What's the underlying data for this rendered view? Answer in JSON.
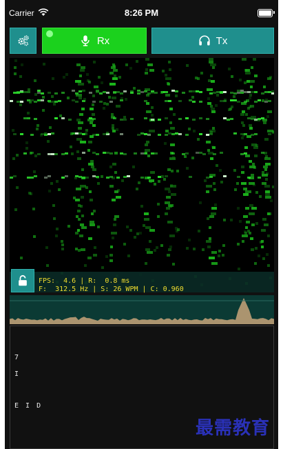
{
  "status_bar": {
    "carrier": "Carrier",
    "time": "8:26 PM"
  },
  "toolbar": {
    "settings_icon": "gears-icon",
    "rx_label": "Rx",
    "rx_icon": "microphone-icon",
    "tx_label": "Tx",
    "tx_icon": "headphones-icon",
    "rx_active": true
  },
  "waterfall": {
    "lock_icon": "unlock-icon"
  },
  "stats": {
    "line1": "FPS:  4.6 | R:  0.8 ms",
    "line2": "F:  312.5 Hz | S: 26 WPM | C: 0.960"
  },
  "decoded_text": {
    "lines": [
      "7",
      "I",
      "E I D"
    ]
  },
  "watermark": "最需教育",
  "colors": {
    "accent_teal": "#1f8f8d",
    "rx_green": "#1bd11d",
    "stats_yellow": "#f3df2f",
    "spectrum_bg": "#0b3a34",
    "watermark_blue": "#2a31b8"
  }
}
